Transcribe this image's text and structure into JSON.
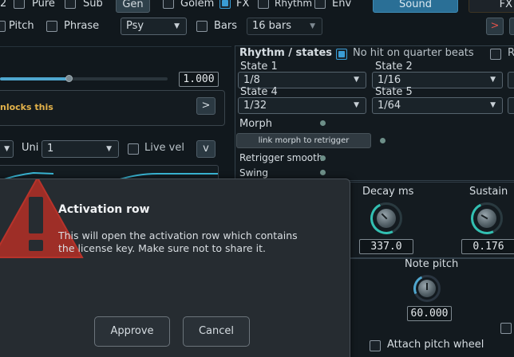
{
  "top_tabs": {
    "partial_label": "2",
    "pure": "Pure",
    "sub": "Sub",
    "gen": "Gen",
    "golem": "Golem",
    "fx": "FX",
    "rhythm": "Rhythm",
    "env": "Env",
    "sound": "Sound",
    "fx_right": "FX"
  },
  "row2": {
    "pitch": "Pitch",
    "phrase": "Phrase",
    "psy_select": "Psy",
    "bars": "Bars",
    "bars_select": "16 bars",
    "arrow_right": ">",
    "square_button": "□"
  },
  "left_panel": {
    "slider_value": "1.000",
    "slider_fill": 0.41,
    "unlock_text": "nlocks this",
    "unlock_button": ">",
    "uni_label": "Uni",
    "uni_value": "1",
    "live_vel": "Live vel",
    "v_button": "v"
  },
  "rhythm": {
    "title": "Rhythm / states",
    "no_hit_label": "No hit on quarter beats",
    "r_label": "R",
    "states": [
      {
        "label": "State 1",
        "value": "1/8"
      },
      {
        "label": "State 2",
        "value": "1/16"
      },
      {
        "label": "State 4",
        "value": "1/32"
      },
      {
        "label": "State 5",
        "value": "1/64"
      }
    ],
    "morph": "Morph",
    "link_morph_button": "link morph to retrigger",
    "retrigger_smooth": "Retrigger smooth",
    "swing": "Swing"
  },
  "envelope": {
    "decay_label": "Decay ms",
    "decay_value": "337.0",
    "sustain_label": "Sustain",
    "sustain_value": "0.176",
    "note_pitch_label": "Note pitch",
    "note_pitch_value": "60.000",
    "attach_pitch_wheel": "Attach pitch wheel"
  },
  "dialog": {
    "title": "Activation row",
    "body": "This will open the activation row which contains the license key. Make sure not to share it.",
    "warning_glyph": "!",
    "approve": "Approve",
    "cancel": "Cancel"
  },
  "colors": {
    "accent": "#3a9cd4",
    "knob_arc": "#32c0b2",
    "warning": "#b8332b",
    "unlock_text": "#e3b24a"
  }
}
